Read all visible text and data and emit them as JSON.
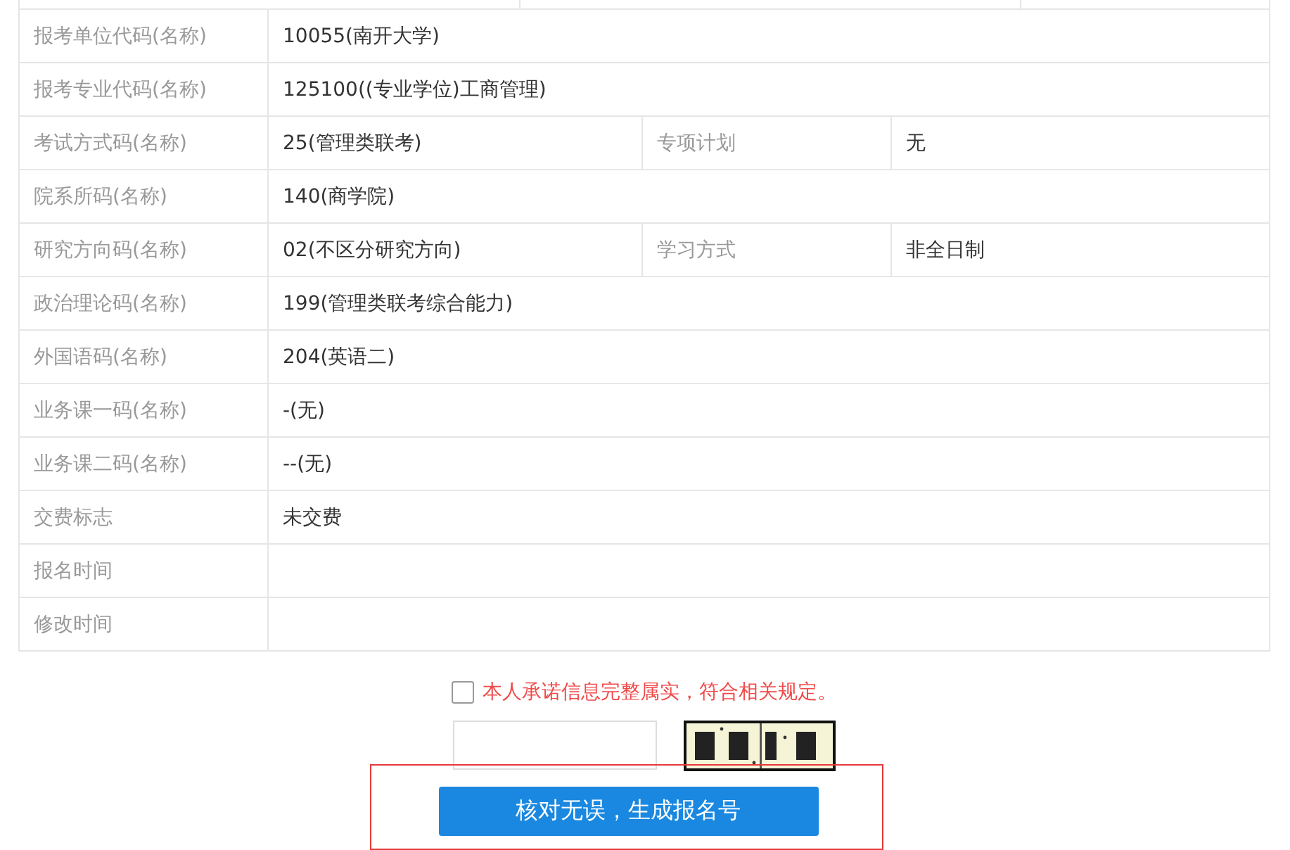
{
  "rows": [
    {
      "cells": [
        {
          "label": "报考单位代码(名称)",
          "value": "10055(南开大学)"
        }
      ]
    },
    {
      "cells": [
        {
          "label": "报考专业代码(名称)",
          "value": "125100((专业学位)工商管理)"
        }
      ]
    },
    {
      "cells": [
        {
          "label": "考试方式码(名称)",
          "value": "25(管理类联考)"
        },
        {
          "label": "专项计划",
          "value": "无"
        }
      ]
    },
    {
      "cells": [
        {
          "label": "院系所码(名称)",
          "value": "140(商学院)"
        }
      ]
    },
    {
      "cells": [
        {
          "label": "研究方向码(名称)",
          "value": "02(不区分研究方向)"
        },
        {
          "label": "学习方式",
          "value": "非全日制"
        }
      ]
    },
    {
      "cells": [
        {
          "label": "政治理论码(名称)",
          "value": "199(管理类联考综合能力)"
        }
      ]
    },
    {
      "cells": [
        {
          "label": "外国语码(名称)",
          "value": "204(英语二)"
        }
      ]
    },
    {
      "cells": [
        {
          "label": "业务课一码(名称)",
          "value": "-(无)"
        }
      ]
    },
    {
      "cells": [
        {
          "label": "业务课二码(名称)",
          "value": "--(无)"
        }
      ]
    },
    {
      "cells": [
        {
          "label": "交费标志",
          "value": "未交费"
        }
      ]
    },
    {
      "cells": [
        {
          "label": "报名时间"
        }
      ]
    },
    {
      "cells": [
        {
          "label": "修改时间"
        }
      ]
    }
  ],
  "pledge": {
    "label": "本人承诺信息完整属实，符合相关规定。",
    "checked": false
  },
  "submit_button": "核对无误，生成报名号"
}
